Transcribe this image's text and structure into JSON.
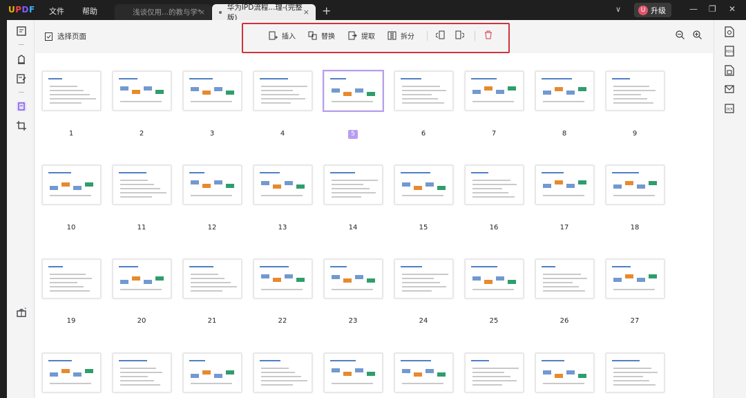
{
  "app": {
    "logo": "UPDF"
  },
  "menu": {
    "file": "文件",
    "help": "帮助"
  },
  "tabs": [
    {
      "label": "浅谈仅用...的教与学*",
      "close": "×"
    },
    {
      "label": "华为IPD流程...理-(完整版)",
      "close": "×"
    }
  ],
  "tab_new": "+",
  "upgrade": {
    "avatar": "U",
    "label": "升级"
  },
  "window": {
    "minimize": "—",
    "maximize": "❐",
    "close": "✕",
    "more": "∨"
  },
  "toolbar": {
    "select_pages": "选择页面",
    "insert": "插入",
    "replace": "替换",
    "extract": "提取",
    "split": "拆分"
  },
  "pages": [
    "1",
    "2",
    "3",
    "4",
    "5",
    "6",
    "7",
    "8",
    "9",
    "10",
    "11",
    "12",
    "13",
    "14",
    "15",
    "16",
    "17",
    "18",
    "19",
    "20",
    "21",
    "22",
    "23",
    "24",
    "25",
    "26",
    "27"
  ],
  "selected_page": "5",
  "colors": {
    "accent": "#b79df2",
    "highlight_box": "#d0323a",
    "delete": "#e0556a"
  }
}
